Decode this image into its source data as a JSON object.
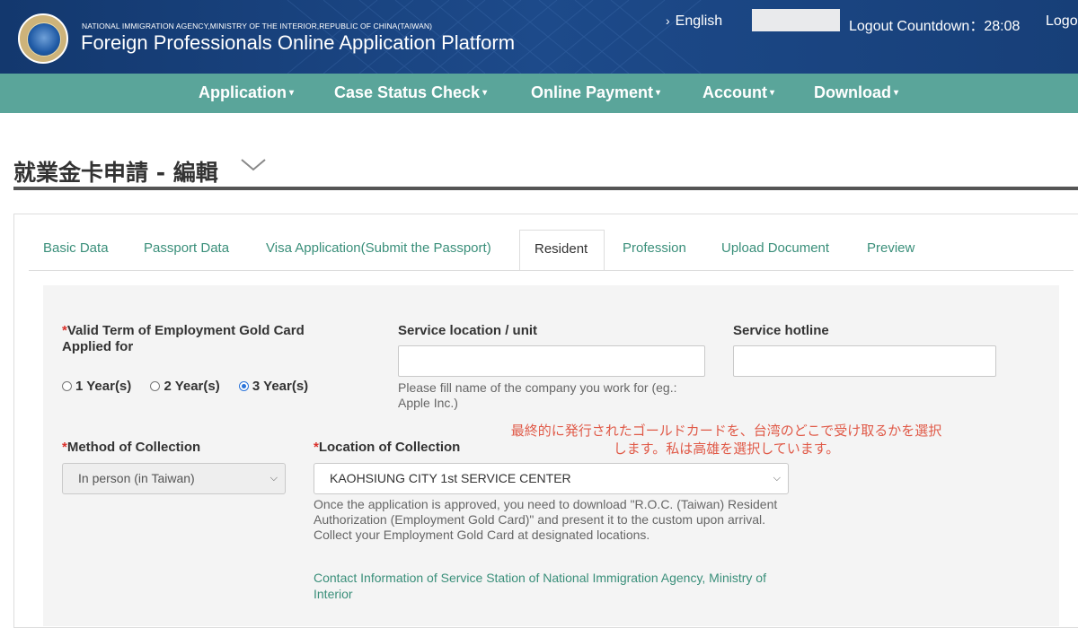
{
  "header": {
    "agency": "NATIONAL IMMIGRATION AGENCY,MINISTRY OF THE INTERIOR,REPUBLIC OF CHINA(TAIWAN)",
    "platform_title": "Foreign Professionals Online Application Platform",
    "language": "English",
    "countdown": "Logout Countdown：28:08",
    "logout": "Logo"
  },
  "nav": {
    "items": [
      {
        "label": "Application"
      },
      {
        "label": "Case Status Check"
      },
      {
        "label": "Online Payment"
      },
      {
        "label": "Account"
      },
      {
        "label": "Download"
      }
    ]
  },
  "page": {
    "title": "就業金卡申請 - 編輯"
  },
  "tabs": {
    "items": [
      {
        "label": "Basic Data"
      },
      {
        "label": "Passport Data"
      },
      {
        "label": "Visa Application(Submit the Passport)"
      },
      {
        "label": "Resident"
      },
      {
        "label": "Profession"
      },
      {
        "label": "Upload Document"
      },
      {
        "label": "Preview"
      }
    ],
    "active": "Resident"
  },
  "form": {
    "valid_term": {
      "label": "Valid Term of Employment Gold Card Applied for",
      "options": [
        "1 Year(s)",
        "2 Year(s)",
        "3 Year(s)"
      ],
      "selected": "3 Year(s)"
    },
    "service_location": {
      "label": "Service location / unit",
      "value": "",
      "help": "Please fill name of the company you work for (eg.: Apple Inc.)"
    },
    "service_hotline": {
      "label": "Service hotline",
      "value": ""
    },
    "method_of_collection": {
      "label": "Method of Collection",
      "value": "In person (in Taiwan)"
    },
    "location_of_collection": {
      "label": "Location of Collection",
      "value": "KAOHSIUNG CITY 1st SERVICE CENTER",
      "help": "Once the application is approved, you need to download \"R.O.C. (Taiwan) Resident Authorization (Employment Gold Card)\" and present it to the custom upon arrival. Collect your Employment Gold Card at designated locations.",
      "contact_link": "Contact Information of Service Station of National Immigration Agency, Ministry of Interior"
    },
    "annotation": "最終的に発行されたゴールドカードを、台湾のどこで受け取るかを選択します。私は高雄を選択しています。"
  },
  "colors": {
    "header_bg": "#173f78",
    "nav_bg": "#5aa59a",
    "accent": "#3a8f7a",
    "required": "#d9302a",
    "annotation": "#e05a48"
  }
}
